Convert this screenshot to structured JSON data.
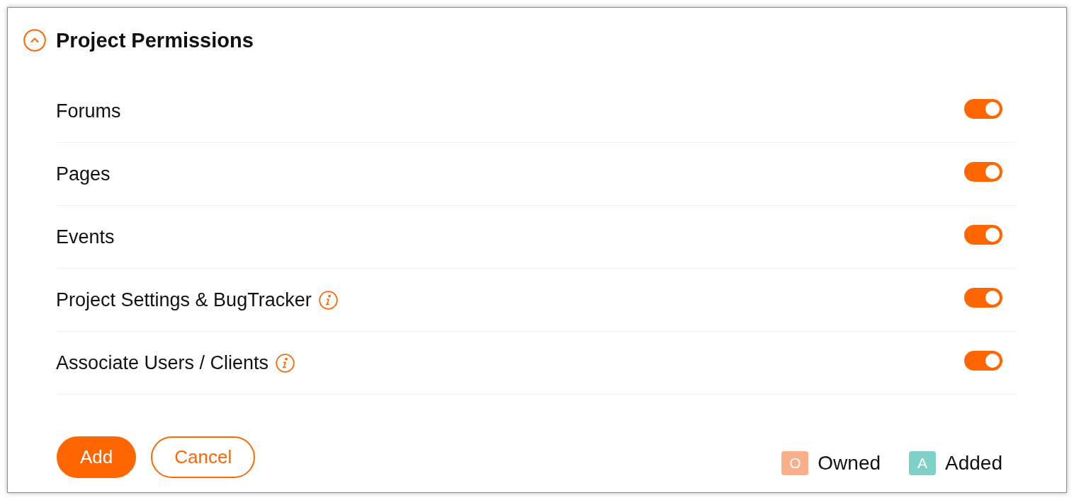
{
  "section": {
    "title": "Project Permissions",
    "expanded": true
  },
  "permissions": [
    {
      "label": "Forums",
      "info": false,
      "on": true
    },
    {
      "label": "Pages",
      "info": false,
      "on": true
    },
    {
      "label": "Events",
      "info": false,
      "on": true
    },
    {
      "label": "Project Settings & BugTracker",
      "info": true,
      "on": true
    },
    {
      "label": "Associate Users / Clients",
      "info": true,
      "on": true
    }
  ],
  "actions": [
    {
      "label": "Add",
      "kind": "primary"
    },
    {
      "label": "Cancel",
      "kind": "secondary"
    }
  ],
  "legend": [
    {
      "letter": "O",
      "label": "Owned",
      "color": "#f9b08a"
    },
    {
      "letter": "A",
      "label": "Added",
      "color": "#80cfc8"
    }
  ]
}
